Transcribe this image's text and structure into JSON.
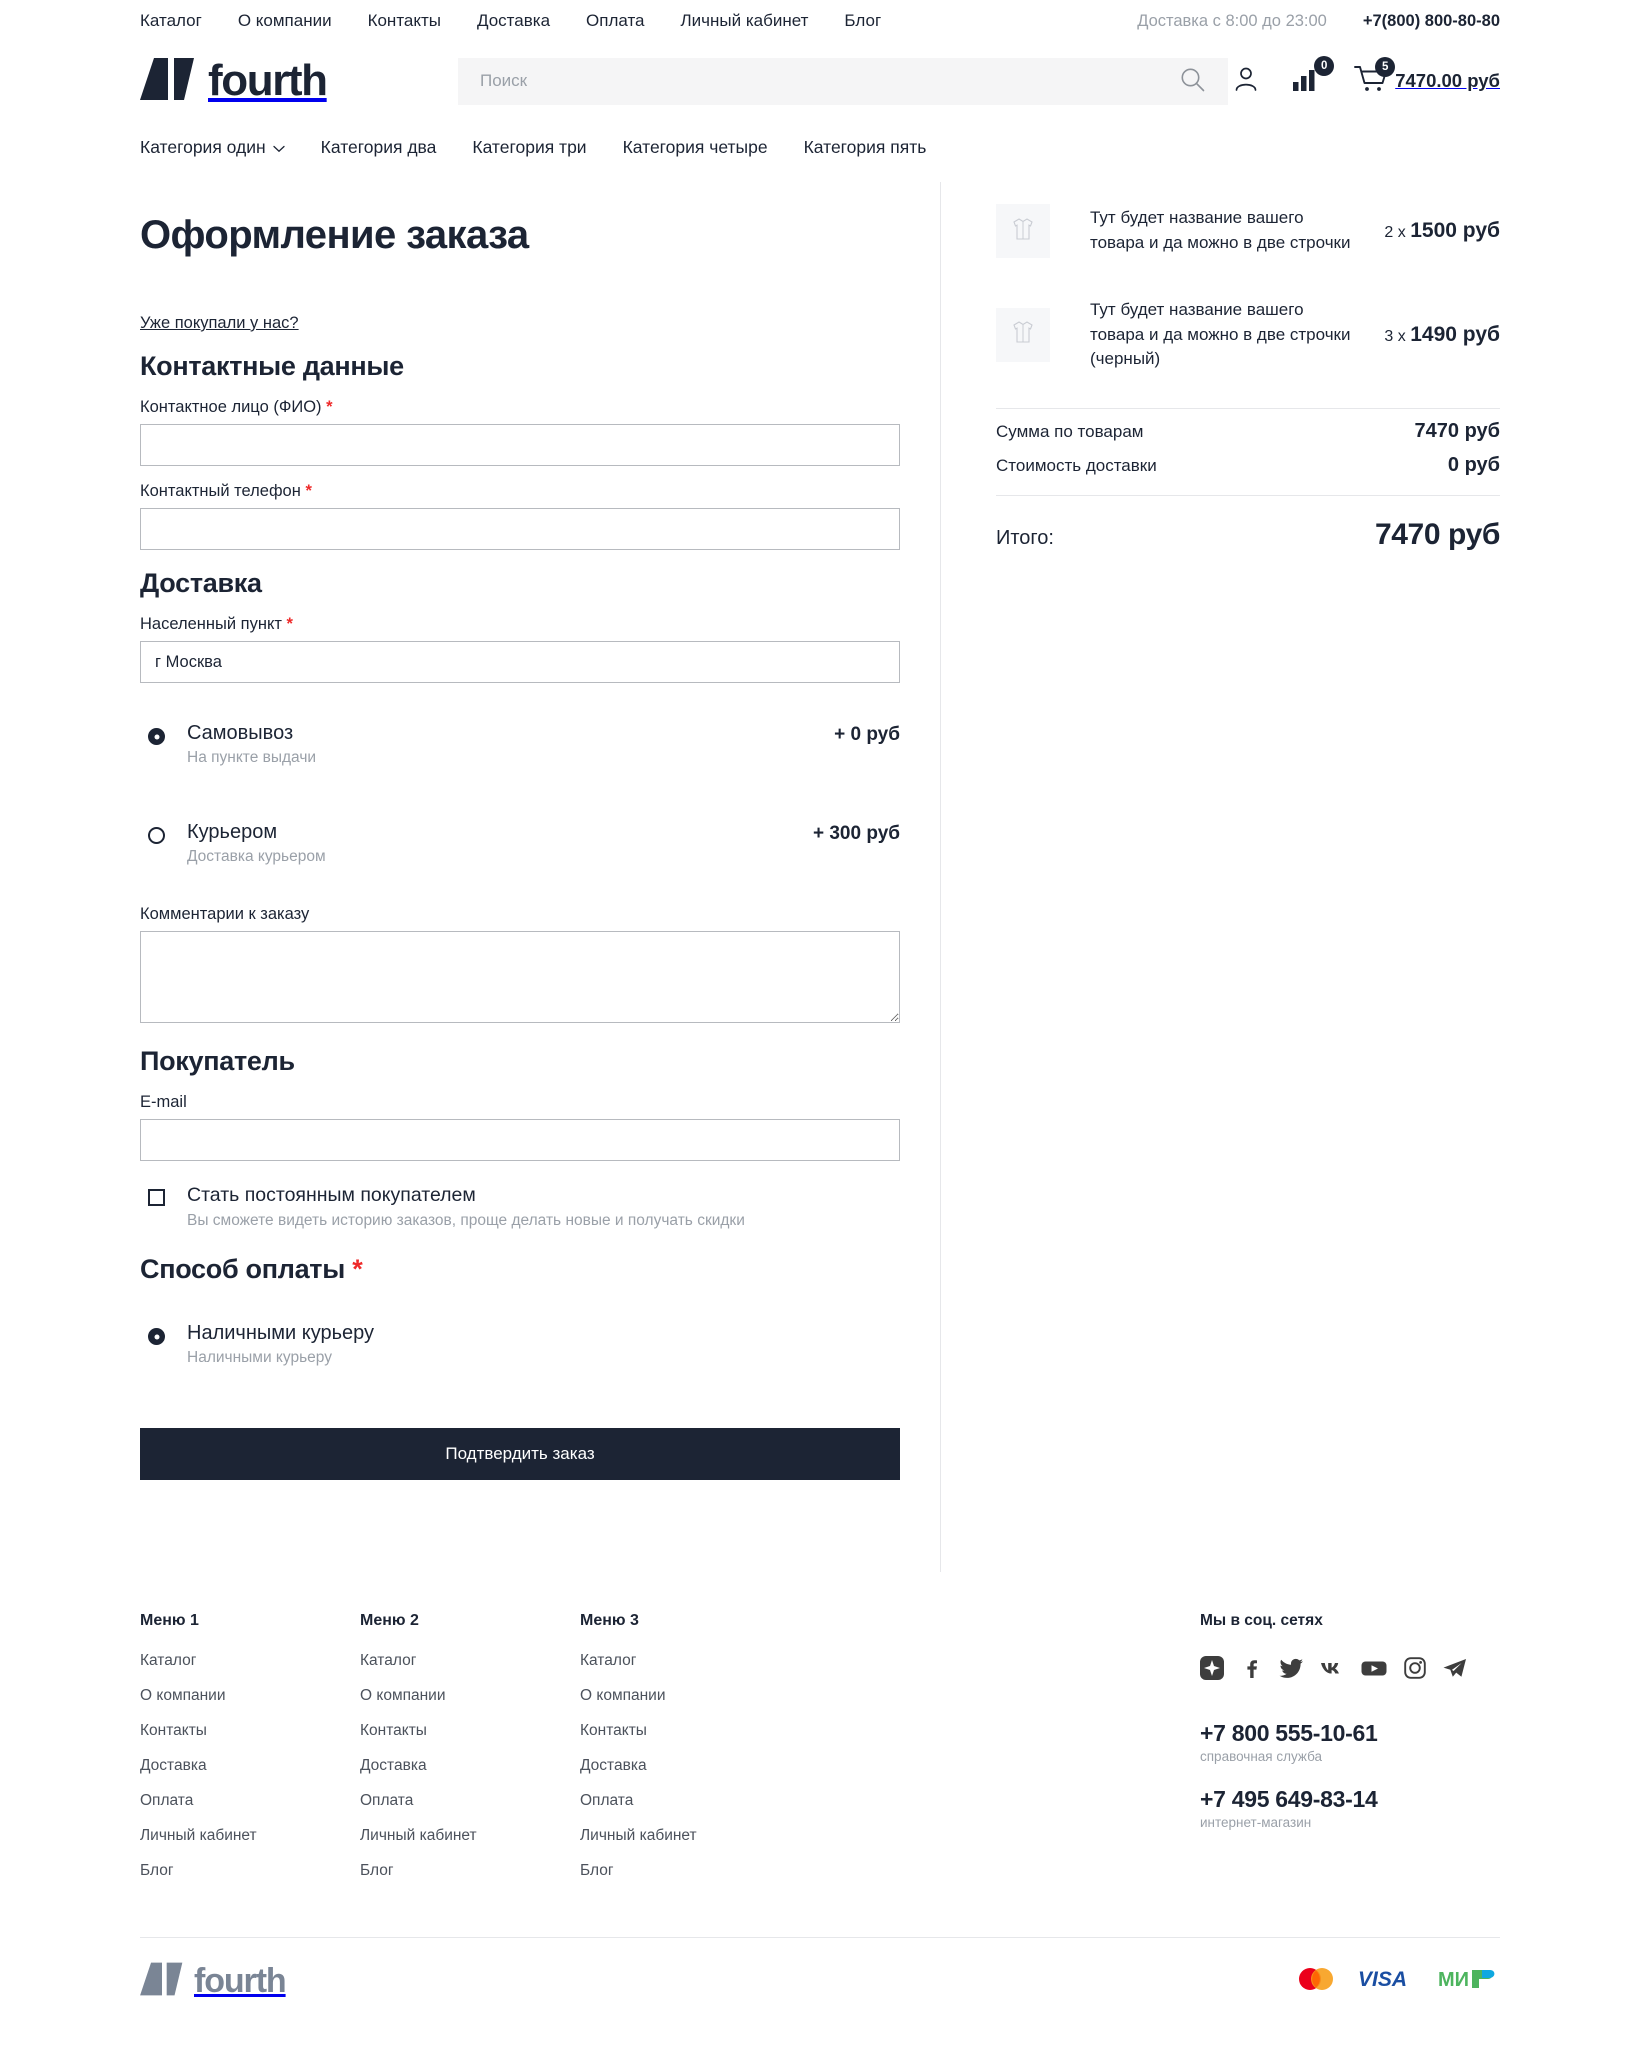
{
  "brand": {
    "name": "fourth",
    "accent": "#1c2434"
  },
  "topbar": {
    "nav": [
      {
        "label": "Каталог"
      },
      {
        "label": "О компании"
      },
      {
        "label": "Контакты"
      },
      {
        "label": "Доставка"
      },
      {
        "label": "Оплата"
      },
      {
        "label": "Личный кабинет"
      },
      {
        "label": "Блог"
      }
    ],
    "schedule": "Доставка с 8:00 до 23:00",
    "phone": "+7(800) 800-80-80"
  },
  "header": {
    "search_placeholder": "Поиск",
    "search_value": "",
    "compare_count": "0",
    "cart_count": "5",
    "cart_total": "7470.00 руб"
  },
  "catnav": [
    {
      "label": "Категория один",
      "has_dropdown": true
    },
    {
      "label": "Категория два",
      "has_dropdown": false
    },
    {
      "label": "Категория три",
      "has_dropdown": false
    },
    {
      "label": "Категория четыре",
      "has_dropdown": false
    },
    {
      "label": "Категория пять",
      "has_dropdown": false
    }
  ],
  "checkout": {
    "title": "Оформление заказа",
    "prev_customer_link": "Уже покупали у нас?",
    "contacts": {
      "heading": "Контактные данные",
      "name_label": "Контактное лицо (ФИО)",
      "name_value": "",
      "phone_label": "Контактный телефон",
      "phone_value": ""
    },
    "delivery": {
      "heading": "Доставка",
      "city_label": "Населенный пункт",
      "city_value": "г Москва",
      "options": [
        {
          "title": "Самовывоз",
          "sub": "На пункте выдачи",
          "price": "+ 0 руб",
          "selected": true
        },
        {
          "title": "Курьером",
          "sub": "Доставка курьером",
          "price": "+ 300 руб",
          "selected": false
        }
      ],
      "comment_label": "Комментарии к заказу",
      "comment_value": ""
    },
    "buyer": {
      "heading": "Покупатель",
      "email_label": "E-mail",
      "email_value": "",
      "regular_title": "Стать постоянным покупателем",
      "regular_sub": "Вы сможете видеть историю заказов, проще делать новые и получать скидки",
      "regular_checked": false
    },
    "payment": {
      "heading": "Способ оплаты",
      "options": [
        {
          "title": "Наличными курьеру",
          "sub": "Наличными курьеру",
          "selected": true
        }
      ]
    },
    "submit_label": "Подтвердить заказ"
  },
  "summary": {
    "products": [
      {
        "name": "Тут будет название вашего товара и да можно в две строчки",
        "qty": "2",
        "price": "1500 руб"
      },
      {
        "name": "Тут будет название вашего товара и да можно в две строчки (черный)",
        "qty": "3",
        "price": "1490 руб"
      }
    ],
    "lines": [
      {
        "label": "Сумма по товарам",
        "value": "7470 руб"
      },
      {
        "label": "Стоимость доставки",
        "value": "0 руб"
      }
    ],
    "total_label": "Итого:",
    "total_value": "7470 руб"
  },
  "footer": {
    "menus": [
      {
        "title": "Меню 1",
        "items": [
          {
            "label": "Каталог"
          },
          {
            "label": "О компании"
          },
          {
            "label": "Контакты"
          },
          {
            "label": "Доставка"
          },
          {
            "label": "Оплата"
          },
          {
            "label": "Личный кабинет"
          },
          {
            "label": "Блог"
          }
        ]
      },
      {
        "title": "Меню 2",
        "items": [
          {
            "label": "Каталог"
          },
          {
            "label": "О компании"
          },
          {
            "label": "Контакты"
          },
          {
            "label": "Доставка"
          },
          {
            "label": "Оплата"
          },
          {
            "label": "Личный кабинет"
          },
          {
            "label": "Блог"
          }
        ]
      },
      {
        "title": "Меню 3",
        "items": [
          {
            "label": "Каталог"
          },
          {
            "label": "О компании"
          },
          {
            "label": "Контакты"
          },
          {
            "label": "Доставка"
          },
          {
            "label": "Оплата"
          },
          {
            "label": "Личный кабинет"
          },
          {
            "label": "Блог"
          }
        ]
      }
    ],
    "social_title": "Мы в соц. сетях",
    "social": [
      {
        "name": "odnoklassniki-icon"
      },
      {
        "name": "facebook-icon"
      },
      {
        "name": "twitter-icon"
      },
      {
        "name": "vk-icon"
      },
      {
        "name": "youtube-icon"
      },
      {
        "name": "instagram-icon"
      },
      {
        "name": "telegram-icon"
      }
    ],
    "phones": [
      {
        "number": "+7 800 555-10-61",
        "note": "справочная служба"
      },
      {
        "number": "+7 495 649-83-14",
        "note": "интернет-магазин"
      }
    ],
    "logo_text": "fourth",
    "paycards": [
      {
        "name": "mastercard-logo",
        "label": "mastercard"
      },
      {
        "name": "visa-logo",
        "label": "VISA"
      },
      {
        "name": "mir-logo",
        "label": "МИР"
      }
    ]
  }
}
